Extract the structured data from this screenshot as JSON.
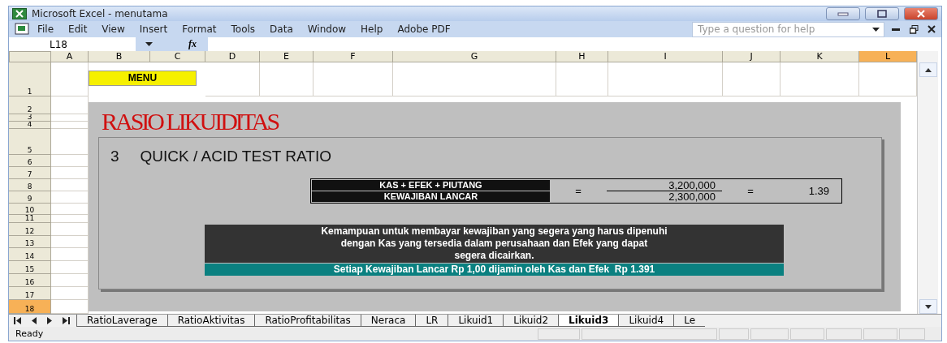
{
  "window": {
    "title": "Microsoft Excel - menutama"
  },
  "menu": [
    "File",
    "Edit",
    "View",
    "Insert",
    "Format",
    "Tools",
    "Data",
    "Window",
    "Help",
    "Adobe PDF"
  ],
  "help_search": {
    "placeholder": "Type a question for help"
  },
  "formula_bar": {
    "name_box": "L18",
    "function_symbol": "fx"
  },
  "columns": [
    {
      "label": "A",
      "selected": false
    },
    {
      "label": "B",
      "selected": false
    },
    {
      "label": "C",
      "selected": false
    },
    {
      "label": "D",
      "selected": false
    },
    {
      "label": "E",
      "selected": false
    },
    {
      "label": "F",
      "selected": false
    },
    {
      "label": "G",
      "selected": false
    },
    {
      "label": "H",
      "selected": false
    },
    {
      "label": "I",
      "selected": false
    },
    {
      "label": "J",
      "selected": false
    },
    {
      "label": "K",
      "selected": false
    },
    {
      "label": "L",
      "selected": true
    }
  ],
  "rows": [
    {
      "label": "1",
      "selected": false
    },
    {
      "label": "2",
      "selected": false
    },
    {
      "label": "3",
      "selected": false
    },
    {
      "label": "4",
      "selected": false
    },
    {
      "label": "5",
      "selected": false
    },
    {
      "label": "6",
      "selected": false
    },
    {
      "label": "7",
      "selected": false
    },
    {
      "label": "8",
      "selected": false
    },
    {
      "label": "9",
      "selected": false
    },
    {
      "label": "10",
      "selected": false
    },
    {
      "label": "11",
      "selected": false
    },
    {
      "label": "12",
      "selected": false
    },
    {
      "label": "13",
      "selected": false
    },
    {
      "label": "14",
      "selected": false
    },
    {
      "label": "15",
      "selected": false
    },
    {
      "label": "16",
      "selected": false
    },
    {
      "label": "17",
      "selected": false
    },
    {
      "label": "18",
      "selected": true
    }
  ],
  "sheet": {
    "menu_button": "MENU",
    "title": "RASIO LIKUIDITAS",
    "section_number": "3",
    "section_title": "QUICK / ACID TEST RATIO",
    "numerator_label": "KAS + EFEK + PIUTANG",
    "denominator_label": "KEWAJIBAN LANCAR",
    "equals": [
      "=",
      "="
    ],
    "numerator": "3,200,000",
    "denominator": "2,300,000",
    "result": "1.39",
    "description": "Kemampuan untuk membayar kewajiban yang segera yang harus dipenuhi\ndengan Kas yang tersedia dalam perusahaan dan Efek yang dapat\nsegera dicairkan.",
    "conclusion": "Setiap Kewajiban Lancar Rp 1,00 dijamin oleh Kas dan Efek  Rp 1.391"
  },
  "sheet_tabs": [
    {
      "label": "RatioLaverage",
      "selected": false
    },
    {
      "label": "RatioAktivitas",
      "selected": false
    },
    {
      "label": "RatioProfitabilitas",
      "selected": false
    },
    {
      "label": "Neraca",
      "selected": false
    },
    {
      "label": "LR",
      "selected": false
    },
    {
      "label": "Likuid1",
      "selected": false
    },
    {
      "label": "Likuid2",
      "selected": false
    },
    {
      "label": "Likuid3",
      "selected": true
    },
    {
      "label": "Likuid4",
      "selected": false
    },
    {
      "label": "Le",
      "selected": false
    }
  ],
  "status_bar": {
    "text": "Ready"
  }
}
